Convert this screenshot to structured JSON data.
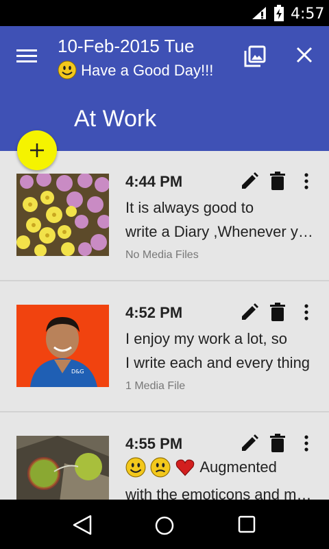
{
  "status_bar": {
    "time": "4:57"
  },
  "header": {
    "date": "10-Feb-2015 Tue",
    "greeting": "Have a Good Day!!!",
    "section_title": "At Work"
  },
  "entries": [
    {
      "time": "4:44 PM",
      "line1": "It is  always good to",
      "line2": "write a Diary ,Whenever you",
      "media": "No Media Files",
      "thumb": "flowers-photo"
    },
    {
      "time": "4:52 PM",
      "line1": "I enjoy  my work a lot, so",
      "line2": "I write each and every thing",
      "media": "1 Media File",
      "thumb": "person-photo"
    },
    {
      "time": "4:55 PM",
      "line1": "Augmented",
      "line2": "with the emoticons and more",
      "media": "",
      "thumb": "fruit-photo"
    }
  ],
  "colors": {
    "primary": "#3f51b5",
    "fab": "#f5f300",
    "background": "#e6e6e6"
  }
}
